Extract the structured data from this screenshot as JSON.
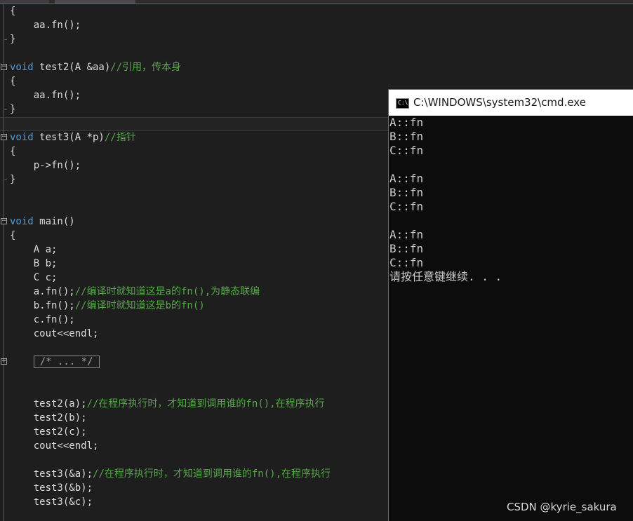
{
  "editor": {
    "lines": [
      [
        {
          "t": "{"
        }
      ],
      [
        {
          "t": "    aa.fn();"
        }
      ],
      [
        {
          "t": "}"
        }
      ],
      [
        {
          "t": ""
        }
      ],
      [
        {
          "t": "void",
          "c": "kw"
        },
        {
          "t": " test2(A &aa)"
        },
        {
          "t": "//引用，传本身",
          "c": "cm"
        }
      ],
      [
        {
          "t": "{"
        }
      ],
      [
        {
          "t": "    aa.fn();"
        }
      ],
      [
        {
          "t": "}"
        }
      ],
      [
        {
          "t": ""
        }
      ],
      [
        {
          "t": "void",
          "c": "kw"
        },
        {
          "t": " test3(A *p)"
        },
        {
          "t": "//指针",
          "c": "cm"
        }
      ],
      [
        {
          "t": "{"
        }
      ],
      [
        {
          "t": "    p->fn();"
        }
      ],
      [
        {
          "t": "}"
        }
      ],
      [
        {
          "t": ""
        }
      ],
      [
        {
          "t": ""
        }
      ],
      [
        {
          "t": "void",
          "c": "kw"
        },
        {
          "t": " main()"
        }
      ],
      [
        {
          "t": "{"
        }
      ],
      [
        {
          "t": "    A a;"
        }
      ],
      [
        {
          "t": "    B b;"
        }
      ],
      [
        {
          "t": "    C c;"
        }
      ],
      [
        {
          "t": "    a.fn();"
        },
        {
          "t": "//编译时就知道这是a的fn(),为静态联编",
          "c": "cm"
        }
      ],
      [
        {
          "t": "    b.fn();"
        },
        {
          "t": "//编译时就知道这是b的fn()",
          "c": "cm"
        }
      ],
      [
        {
          "t": "    c.fn();"
        }
      ],
      [
        {
          "t": "    cout<<endl;"
        }
      ],
      [
        {
          "t": ""
        }
      ],
      [
        {
          "t": "    "
        },
        {
          "t": "/* ... */",
          "c": "box"
        }
      ],
      [
        {
          "t": ""
        }
      ],
      [
        {
          "t": ""
        }
      ],
      [
        {
          "t": "    test2(a);"
        },
        {
          "t": "//在程序执行时，才知道到调用谁的fn(),在程序执行",
          "c": "cm"
        }
      ],
      [
        {
          "t": "    test2(b);"
        }
      ],
      [
        {
          "t": "    test2(c);"
        }
      ],
      [
        {
          "t": "    cout<<endl;"
        }
      ],
      [
        {
          "t": ""
        }
      ],
      [
        {
          "t": "    test3(&a);"
        },
        {
          "t": "//在程序执行时，才知道到调用谁的fn(),在程序执行",
          "c": "cm"
        }
      ],
      [
        {
          "t": "    test3(&b);"
        }
      ],
      [
        {
          "t": "    test3(&c);"
        }
      ]
    ]
  },
  "cmd": {
    "title": "C:\\WINDOWS\\system32\\cmd.exe",
    "icon_label": "C:\\.",
    "output": [
      "A::fn",
      "B::fn",
      "C::fn",
      "",
      "A::fn",
      "B::fn",
      "C::fn",
      "",
      "A::fn",
      "B::fn",
      "C::fn",
      "请按任意键继续. . ."
    ]
  },
  "watermark": "CSDN @kyrie_sakura"
}
